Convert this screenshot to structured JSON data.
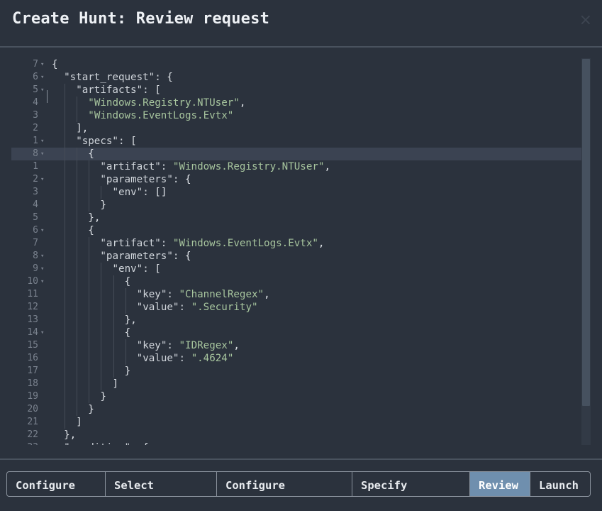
{
  "dialog": {
    "title": "Create Hunt: Review request",
    "close_icon": "×"
  },
  "editor": {
    "lines": [
      {
        "num": "7",
        "fold": true,
        "active": false,
        "indent": 0,
        "text": "{"
      },
      {
        "num": "6",
        "fold": true,
        "active": false,
        "indent": 1,
        "text": "\"start_request\": {"
      },
      {
        "num": "5",
        "fold": true,
        "active": false,
        "indent": 2,
        "text": "\"artifacts\": ["
      },
      {
        "num": "4",
        "fold": false,
        "active": false,
        "indent": 3,
        "text": "\"Windows.Registry.NTUser\","
      },
      {
        "num": "3",
        "fold": false,
        "active": false,
        "indent": 3,
        "text": "\"Windows.EventLogs.Evtx\""
      },
      {
        "num": "2",
        "fold": false,
        "active": false,
        "indent": 2,
        "text": "],"
      },
      {
        "num": "1",
        "fold": true,
        "active": false,
        "indent": 2,
        "text": "\"specs\": ["
      },
      {
        "num": "8",
        "fold": true,
        "active": true,
        "indent": 3,
        "text": "{"
      },
      {
        "num": "1",
        "fold": false,
        "active": false,
        "indent": 4,
        "text": "\"artifact\": \"Windows.Registry.NTUser\","
      },
      {
        "num": "2",
        "fold": true,
        "active": false,
        "indent": 4,
        "text": "\"parameters\": {"
      },
      {
        "num": "3",
        "fold": false,
        "active": false,
        "indent": 5,
        "text": "\"env\": []"
      },
      {
        "num": "4",
        "fold": false,
        "active": false,
        "indent": 4,
        "text": "}"
      },
      {
        "num": "5",
        "fold": false,
        "active": false,
        "indent": 3,
        "text": "},"
      },
      {
        "num": "6",
        "fold": true,
        "active": false,
        "indent": 3,
        "text": "{"
      },
      {
        "num": "7",
        "fold": false,
        "active": false,
        "indent": 4,
        "text": "\"artifact\": \"Windows.EventLogs.Evtx\","
      },
      {
        "num": "8",
        "fold": true,
        "active": false,
        "indent": 4,
        "text": "\"parameters\": {"
      },
      {
        "num": "9",
        "fold": true,
        "active": false,
        "indent": 5,
        "text": "\"env\": ["
      },
      {
        "num": "10",
        "fold": true,
        "active": false,
        "indent": 6,
        "text": "{"
      },
      {
        "num": "11",
        "fold": false,
        "active": false,
        "indent": 7,
        "text": "\"key\": \"ChannelRegex\","
      },
      {
        "num": "12",
        "fold": false,
        "active": false,
        "indent": 7,
        "text": "\"value\": \".Security\""
      },
      {
        "num": "13",
        "fold": false,
        "active": false,
        "indent": 6,
        "text": "},"
      },
      {
        "num": "14",
        "fold": true,
        "active": false,
        "indent": 6,
        "text": "{"
      },
      {
        "num": "15",
        "fold": false,
        "active": false,
        "indent": 7,
        "text": "\"key\": \"IDRegex\","
      },
      {
        "num": "16",
        "fold": false,
        "active": false,
        "indent": 7,
        "text": "\"value\": \".4624\""
      },
      {
        "num": "17",
        "fold": false,
        "active": false,
        "indent": 6,
        "text": "}"
      },
      {
        "num": "18",
        "fold": false,
        "active": false,
        "indent": 5,
        "text": "]"
      },
      {
        "num": "19",
        "fold": false,
        "active": false,
        "indent": 4,
        "text": "}"
      },
      {
        "num": "20",
        "fold": false,
        "active": false,
        "indent": 3,
        "text": "}"
      },
      {
        "num": "21",
        "fold": false,
        "active": false,
        "indent": 2,
        "text": "]"
      },
      {
        "num": "22",
        "fold": false,
        "active": false,
        "indent": 1,
        "text": "},"
      },
      {
        "num": "23",
        "fold": false,
        "active": false,
        "indent": 1,
        "text": "\"condition\": {"
      }
    ]
  },
  "steps": [
    {
      "label": "Configure\nHunt",
      "active": false
    },
    {
      "label": "Select\nArtifacts",
      "active": false
    },
    {
      "label": "Configure\nParameters",
      "active": false
    },
    {
      "label": "Specify\nResources",
      "active": false
    },
    {
      "label": "Review",
      "active": true
    },
    {
      "label": "Launch",
      "active": false
    }
  ],
  "colors": {
    "background": "#2b323d",
    "active_line": "#3b4352",
    "string": "#a7c59e",
    "active_step": "#6f8fae"
  }
}
